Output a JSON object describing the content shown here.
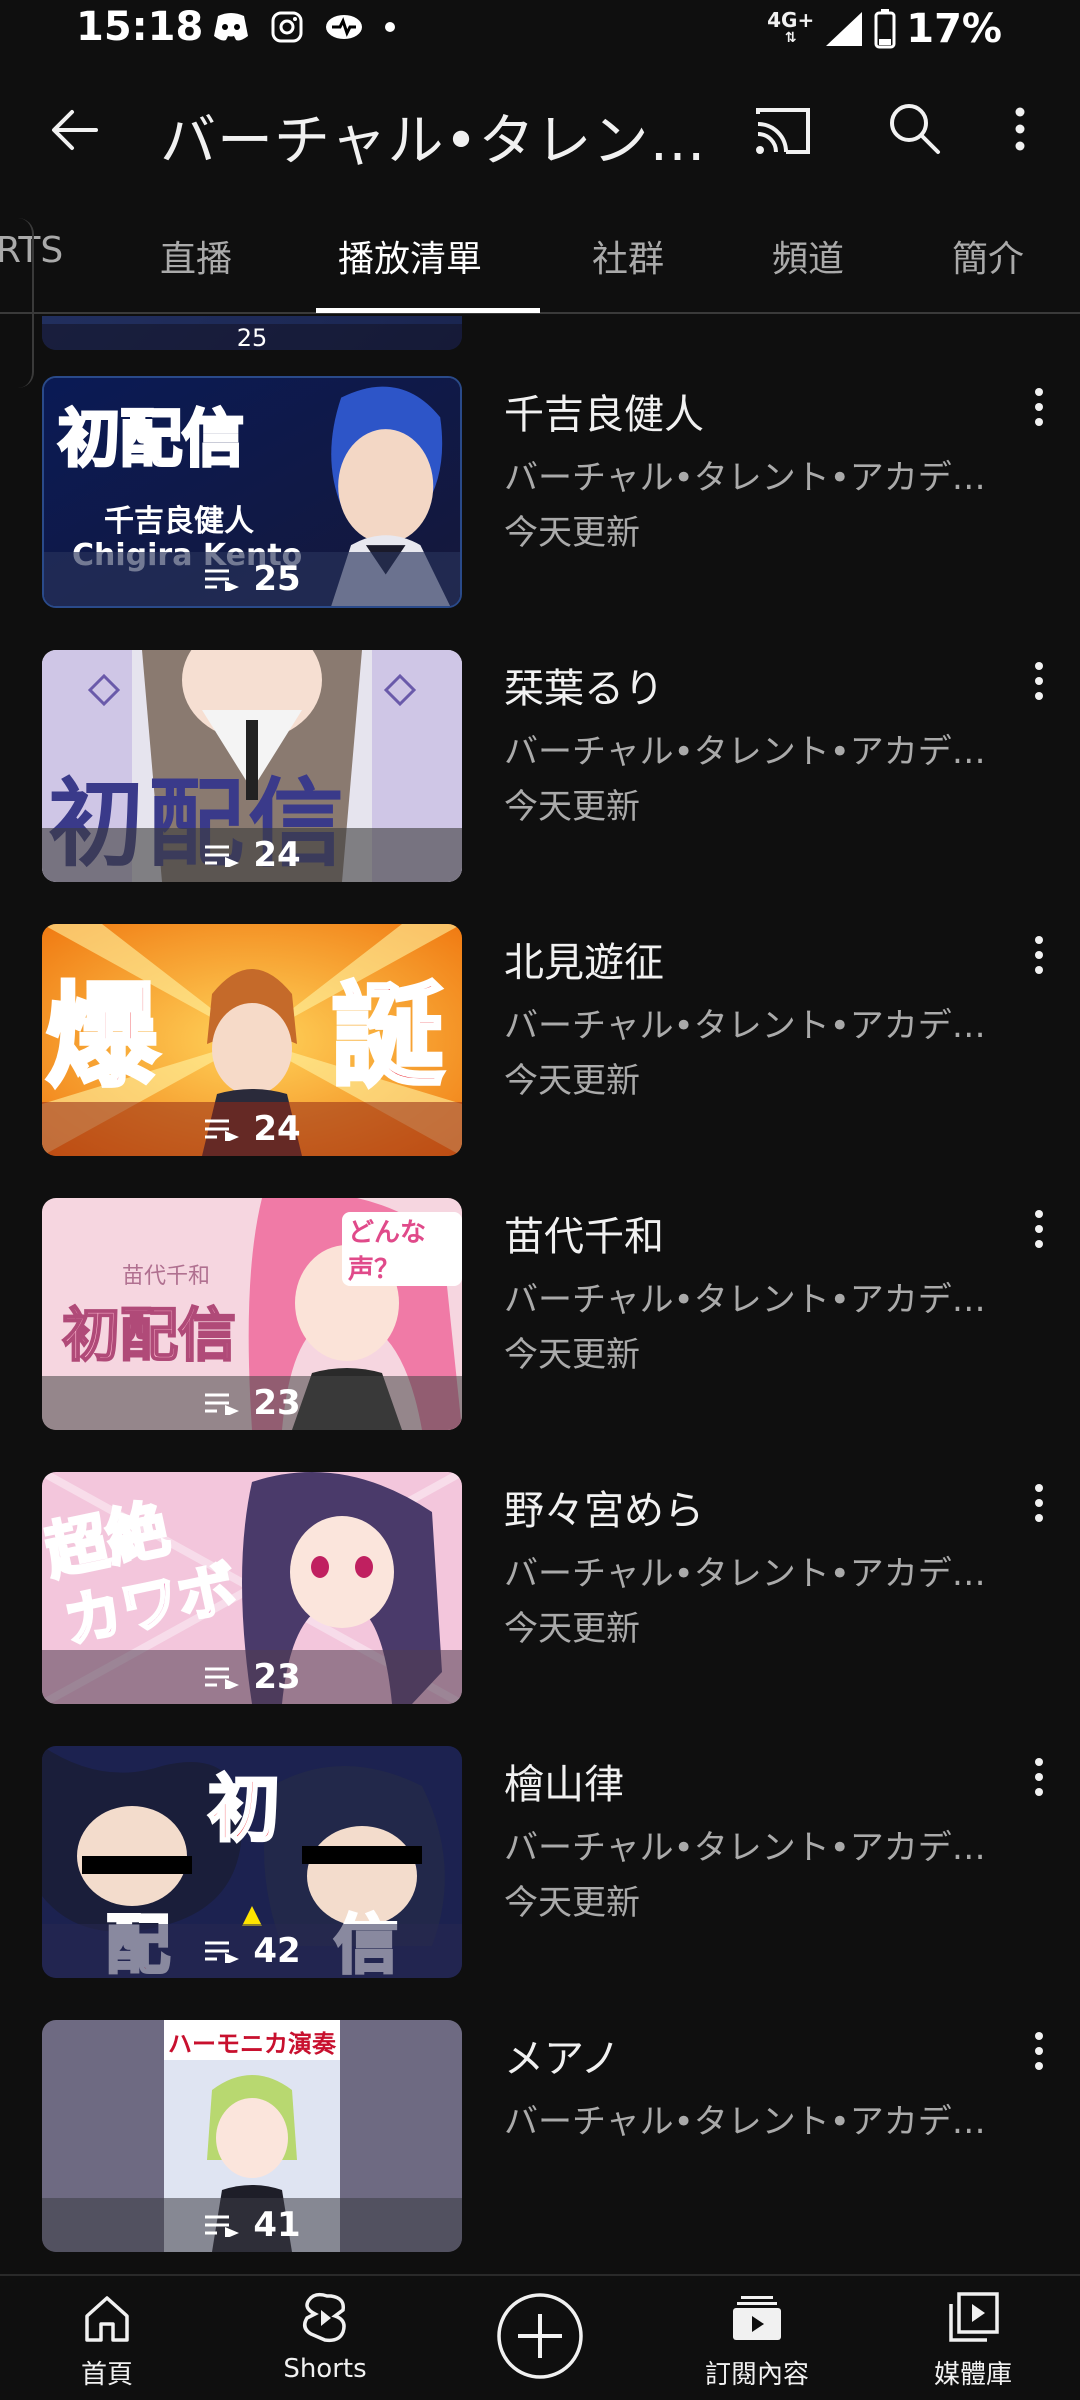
{
  "status_bar": {
    "time": "15:18",
    "network": "4G",
    "network_plus": "+",
    "battery": "17%"
  },
  "app_bar": {
    "title": "バーチャル•タレント•アカデミー"
  },
  "tabs": [
    {
      "label": "RTS"
    },
    {
      "label": "直播"
    },
    {
      "label": "播放清單"
    },
    {
      "label": "社群"
    },
    {
      "label": "頻道"
    },
    {
      "label": "簡介"
    }
  ],
  "partial_item": {
    "count": "25"
  },
  "playlists": [
    {
      "title": "千吉良健人",
      "channel": "バーチャル•タレント•アカデミー",
      "updated": "今天更新",
      "count": "25",
      "thumb_text": "初配信",
      "thumb_sub": "千吉良健人",
      "thumb_sub2": "Chigira Kento"
    },
    {
      "title": "栞葉るり",
      "channel": "バーチャル•タレント•アカデミー",
      "updated": "今天更新",
      "count": "24",
      "thumb_text": "初配信"
    },
    {
      "title": "北見遊征",
      "channel": "バーチャル•タレント•アカデミー",
      "updated": "今天更新",
      "count": "24",
      "thumb_text_left": "爆",
      "thumb_text_right": "誕"
    },
    {
      "title": "苗代千和",
      "channel": "バーチャル•タレント•アカデミー",
      "updated": "今天更新",
      "count": "23",
      "thumb_text": "初配信",
      "thumb_sub": "苗代千和",
      "thumb_tag": "どんな声？"
    },
    {
      "title": "野々宮めら",
      "channel": "バーチャル•タレント•アカデミー",
      "updated": "今天更新",
      "count": "23",
      "thumb_text": "超絶",
      "thumb_text2": "カワボ"
    },
    {
      "title": "檜山律",
      "channel": "バーチャル•タレント•アカデミー",
      "updated": "今天更新",
      "count": "42",
      "thumb_text": "初",
      "thumb_text_l": "配",
      "thumb_text_r": "信"
    },
    {
      "title": "メアノ",
      "channel": "バーチャル•タレント•アカデミー",
      "updated": "",
      "count": "41",
      "thumb_text": "ハーモニカ演奏"
    }
  ],
  "bottom_nav": [
    {
      "label": "首頁",
      "icon": "home-icon"
    },
    {
      "label": "Shorts",
      "icon": "shorts-icon"
    },
    {
      "label": "",
      "icon": "create-icon"
    },
    {
      "label": "訂閱內容",
      "icon": "subscriptions-icon"
    },
    {
      "label": "媒體庫",
      "icon": "library-icon"
    }
  ],
  "colors": {
    "background": "#0f0f0f",
    "text_primary": "#f1f1f1",
    "text_secondary": "#aaaaaa"
  }
}
